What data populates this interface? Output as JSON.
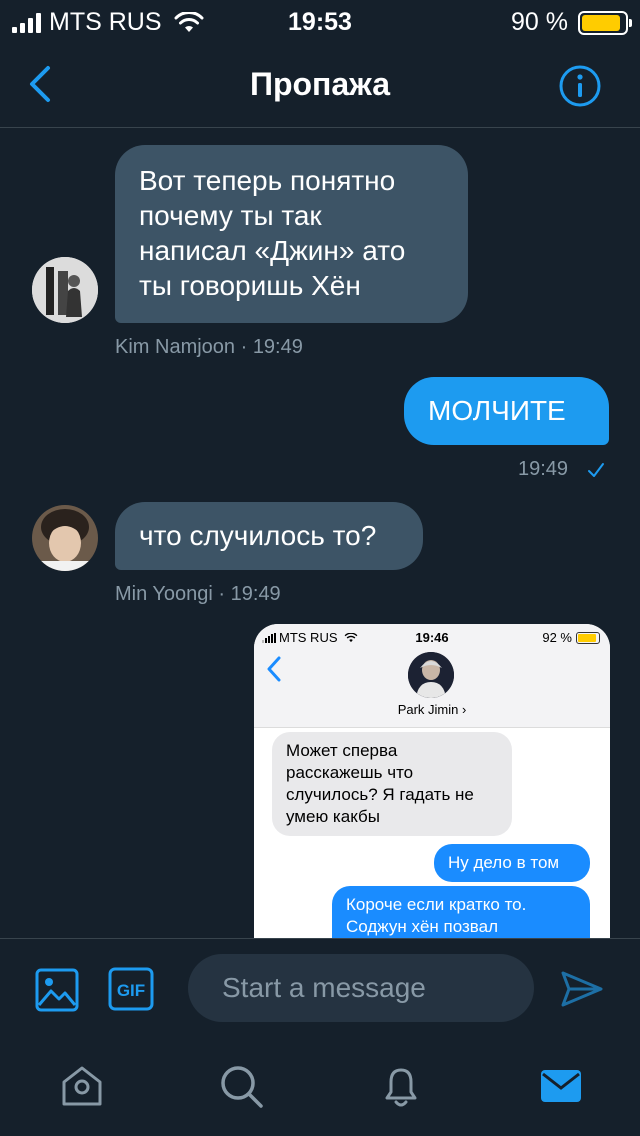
{
  "status_bar": {
    "carrier": "MTS RUS",
    "time": "19:53",
    "battery_percent": "90 %",
    "battery_level": 0.9
  },
  "header": {
    "title": "Пропажа",
    "back_icon": "chevron-left-icon",
    "info_icon": "info-circle-icon"
  },
  "messages": [
    {
      "direction": "incoming",
      "lines": [
        "Вот теперь понятно",
        "почему ты так",
        "написал «Джин» ато",
        "ты говоришь Хён"
      ],
      "meta": "Kim Namjoon · 19:49"
    },
    {
      "direction": "outgoing",
      "text": "МОЛЧИТЕ",
      "meta": "19:49",
      "status_icon": "checkmark-icon"
    },
    {
      "direction": "incoming",
      "text": "что случилось то?",
      "meta": "Min Yoongi · 19:49"
    }
  ],
  "attached_screenshot": {
    "carrier": "MTS RUS",
    "time": "19:46",
    "battery": "92 %",
    "battery_level": 0.92,
    "contact_name": "Park Jimin ›",
    "messages": [
      {
        "direction": "incoming",
        "lines": [
          "Может сперва",
          "расскажешь что",
          "случилось? Я гадать не",
          "умею какбы"
        ]
      },
      {
        "direction": "outgoing",
        "lines": [
          "Ну дело в том"
        ]
      },
      {
        "direction": "outgoing",
        "lines": [
          "Короче если кратко то.",
          "Соджун хён позвал"
        ]
      }
    ]
  },
  "compose": {
    "placeholder": "Start a message",
    "gif_label": "GIF",
    "image_icon": "image-icon",
    "send_icon": "send-icon"
  },
  "tab_bar": {
    "items": [
      "home-icon",
      "search-icon",
      "notifications-icon",
      "messages-icon"
    ],
    "active": "messages-icon"
  },
  "colors": {
    "background": "#15202b",
    "incoming_bubble": "#3d5466",
    "outgoing_bubble": "#1d9bf0",
    "accent": "#1d9bf0",
    "meta_text": "#8899a6"
  }
}
